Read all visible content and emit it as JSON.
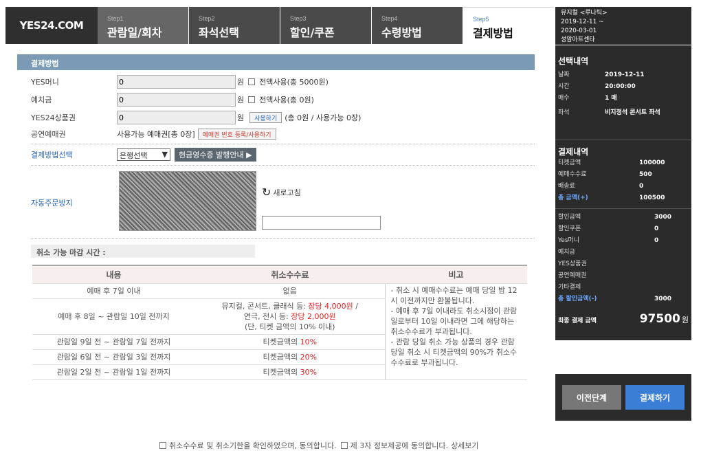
{
  "logo": "YES24.COM",
  "steps": [
    {
      "num": "Step1",
      "name": "관람일/회차"
    },
    {
      "num": "Step2",
      "name": "좌석선택"
    },
    {
      "num": "Step3",
      "name": "할인/쿠폰"
    },
    {
      "num": "Step4",
      "name": "수령방법"
    },
    {
      "num": "Step5",
      "name": "결제방법"
    }
  ],
  "show_info": {
    "title": "뮤지컬 <루나틱>",
    "period_start": "2019-12-11 ~",
    "period_end": "2020-03-01",
    "venue": "성암아트센타"
  },
  "selection": {
    "title": "선택내역",
    "rows": [
      {
        "k": "날짜",
        "v": "2019-12-11"
      },
      {
        "k": "시간",
        "v": "20:00:00"
      },
      {
        "k": "매수",
        "v": "1 매"
      },
      {
        "k": "좌석",
        "v": "비지정석 콘서트 좌석"
      }
    ]
  },
  "payment": {
    "title": "결제내역",
    "rows": [
      {
        "k": "티켓금액",
        "v": "100000"
      },
      {
        "k": "예매수수료",
        "v": "500"
      },
      {
        "k": "배송료",
        "v": "0"
      },
      {
        "k": "총 금액(+)",
        "v": "100500"
      }
    ],
    "discount_rows": [
      {
        "k": "할인금액",
        "v": "3000"
      },
      {
        "k": "할인쿠폰",
        "v": "0"
      },
      {
        "k": "Yes머니",
        "v": "0"
      },
      {
        "k": "예치금",
        "v": ""
      },
      {
        "k": "YES상품권",
        "v": ""
      },
      {
        "k": "공연예매권",
        "v": ""
      },
      {
        "k": "기타결제",
        "v": ""
      },
      {
        "k": "총 할인금액(-)",
        "v": "3000"
      }
    ],
    "final_label": "최종 결제 금액",
    "final_value": "97500",
    "final_unit": "원"
  },
  "buttons": {
    "prev": "이전단계",
    "pay": "결제하기"
  },
  "section_title": "결제방법",
  "form": {
    "yesmoney": {
      "label": "YES머니",
      "value": "0",
      "unit": "원",
      "all_use": "전액사용(총 5000원)"
    },
    "deposit": {
      "label": "예치금",
      "value": "0",
      "unit": "원",
      "all_use": "전액사용(총 0원)"
    },
    "giftcard": {
      "label": "YES24상품권",
      "value": "0",
      "unit": "원",
      "use_btn": "사용하기",
      "info": "(총 0원 / 사용가능 0장)"
    },
    "voucher": {
      "label": "공연예매권",
      "info": "사용가능 예매권[총 0장]",
      "register_btn": "예매권 번호 등록/사용하기"
    },
    "method": {
      "label": "결제방법선택",
      "selected": "은행선택",
      "receipt_btn": "현금영수증 발행안내 ▶"
    },
    "captcha": {
      "label": "자동주문방지",
      "refresh": "새로고침",
      "input_value": ""
    }
  },
  "cancel": {
    "title": "취소 가능 마감 시간 :",
    "headers": [
      "내용",
      "취소수수료",
      "비고"
    ],
    "rows": [
      {
        "content": "예매 후 7일 이내",
        "fee_parts": [
          {
            "t": "없음",
            "red": false
          }
        ]
      },
      {
        "content": "예매 후 8일 ~ 관람일 10일 전까지",
        "fee_parts": [
          {
            "t": "뮤지컬, 콘서트, 클래식 등: ",
            "red": false
          },
          {
            "t": "장당 4,000원",
            "red": true
          },
          {
            "t": " /",
            "red": false
          },
          {
            "br": true
          },
          {
            "t": "연극, 전시 등: ",
            "red": false
          },
          {
            "t": "장당 2,000원",
            "red": true
          },
          {
            "br": true
          },
          {
            "t": "(단, 티켓 금액의 10% 이내)",
            "red": false
          }
        ]
      },
      {
        "content": "관람일 9일 전 ~ 관람일 7일 전까지",
        "fee_parts": [
          {
            "t": "티켓금액의 ",
            "red": false
          },
          {
            "t": "10%",
            "red": true
          }
        ]
      },
      {
        "content": "관람일 6일 전 ~ 관람일 3일 전까지",
        "fee_parts": [
          {
            "t": "티켓금액의 ",
            "red": false
          },
          {
            "t": "20%",
            "red": true
          }
        ]
      },
      {
        "content": "관람일 2일 전 ~ 관람일 1일 전까지",
        "fee_parts": [
          {
            "t": "티켓금액의 ",
            "red": false
          },
          {
            "t": "30%",
            "red": true
          }
        ]
      }
    ],
    "note": "- 취소 시 예매수수료는 예매 당일 밤 12시 이전까지만 환불됩니다.\n- 예매 후 7일 이내라도 취소시점이 관람일로부터 10일 이내라면 그에 해당하는 취소수수료가 부과됩니다.\n- 관람 당일 취소 가능 상품의 경우 관람 당일 취소 시 티켓금액의 90%가 취소수수수료로 부과됩니다."
  },
  "agree": {
    "cancel_agree": "취소수수료 및 취소기한을 확인하였으며, 동의합니다.",
    "third_party": "제 3자 정보제공에 동의합니다.",
    "detail": "상세보기"
  }
}
